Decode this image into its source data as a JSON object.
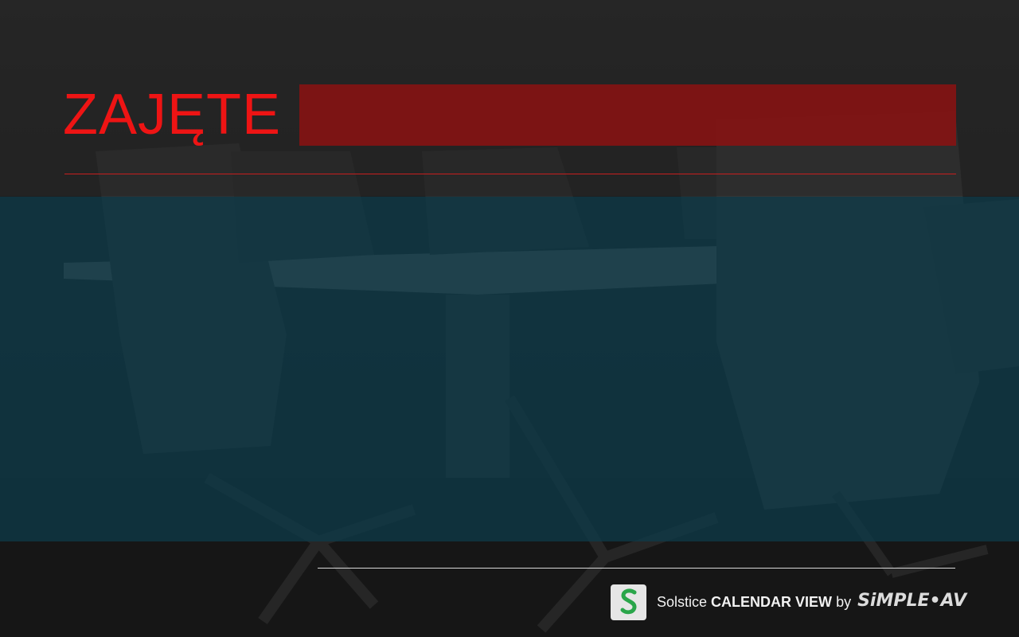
{
  "status": {
    "label": "ZAJĘTE",
    "color": "#ee1414"
  },
  "footer": {
    "product_name": "Solstice",
    "product_view": "CALENDAR VIEW",
    "by": "by",
    "vendor_logo_text": "SiMPLE•AV",
    "logo_icon": "solstice-logo-icon"
  },
  "colors": {
    "status_bar": "#8c1212",
    "content_panel": "#0e3a48",
    "divider_top": "#c81e1e",
    "divider_bottom": "#d8d8d8"
  }
}
